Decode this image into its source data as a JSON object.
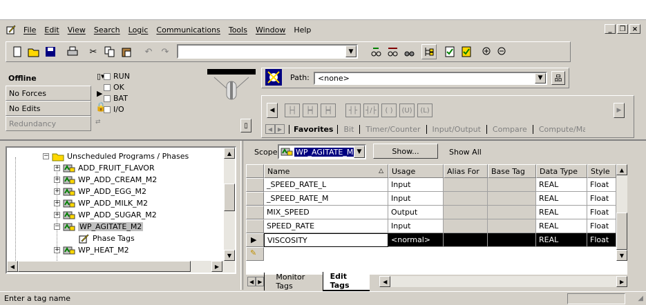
{
  "menu": {
    "items": [
      "File",
      "Edit",
      "View",
      "Search",
      "Logic",
      "Communications",
      "Tools",
      "Window",
      "Help"
    ]
  },
  "window_buttons": {
    "minimize": "_",
    "restore": "❐",
    "close": "×"
  },
  "status": {
    "mode": "Offline",
    "forces": "No Forces",
    "edits": "No Edits",
    "redundancy": "Redundancy",
    "run": "RUN",
    "ok": "OK",
    "bat": "BAT",
    "io": "I/O"
  },
  "path": {
    "label": "Path:",
    "value": "<none>"
  },
  "instr_tabs": [
    "Favorites",
    "Bit",
    "Timer/Counter",
    "Input/Output",
    "Compare",
    "Compute/Ma"
  ],
  "tree": {
    "items": [
      {
        "label": "Unscheduled Programs / Phases",
        "type": "folder",
        "expander": "−"
      },
      {
        "label": "ADD_FRUIT_FLAVOR",
        "type": "program",
        "expander": "+"
      },
      {
        "label": "WP_ADD_CREAM_M2",
        "type": "program",
        "expander": "+"
      },
      {
        "label": "WP_ADD_EGG_M2",
        "type": "program",
        "expander": "+"
      },
      {
        "label": "WP_ADD_MILK_M2",
        "type": "program",
        "expander": "+"
      },
      {
        "label": "WP_ADD_SUGAR_M2",
        "type": "program",
        "expander": "+"
      },
      {
        "label": "WP_AGITATE_M2",
        "type": "program",
        "expander": "−",
        "selected": true
      },
      {
        "label": "Phase Tags",
        "type": "tags",
        "expander": ""
      },
      {
        "label": "WP_HEAT_M2",
        "type": "program",
        "expander": "+"
      }
    ]
  },
  "scope": {
    "label": "Scope:",
    "value": "WP_AGITATE_M",
    "show_button": "Show...",
    "show_all": "Show All"
  },
  "grid": {
    "columns": [
      "Name",
      "Usage",
      "Alias For",
      "Base Tag",
      "Data Type",
      "Style"
    ],
    "rows": [
      {
        "name": "_SPEED_RATE_L",
        "usage": "Input",
        "alias": "",
        "base": "",
        "type": "REAL",
        "style": "Float"
      },
      {
        "name": "_SPEED_RATE_M",
        "usage": "Input",
        "alias": "",
        "base": "",
        "type": "REAL",
        "style": "Float"
      },
      {
        "name": "MIX_SPEED",
        "usage": "Output",
        "alias": "",
        "base": "",
        "type": "REAL",
        "style": "Float"
      },
      {
        "name": "SPEED_RATE",
        "usage": "Input",
        "alias": "",
        "base": "",
        "type": "REAL",
        "style": "Float"
      },
      {
        "name": "VISCOSITY",
        "usage": "<normal>",
        "alias": "",
        "base": "",
        "type": "REAL",
        "style": "Float"
      }
    ]
  },
  "bottom_tabs": [
    "Monitor Tags",
    "Edit Tags"
  ],
  "statusbar": {
    "text": "Enter a tag name"
  },
  "colors": {
    "bg": "#d4d0c8",
    "selected": "#000000",
    "selected_text": "#ffffff"
  }
}
